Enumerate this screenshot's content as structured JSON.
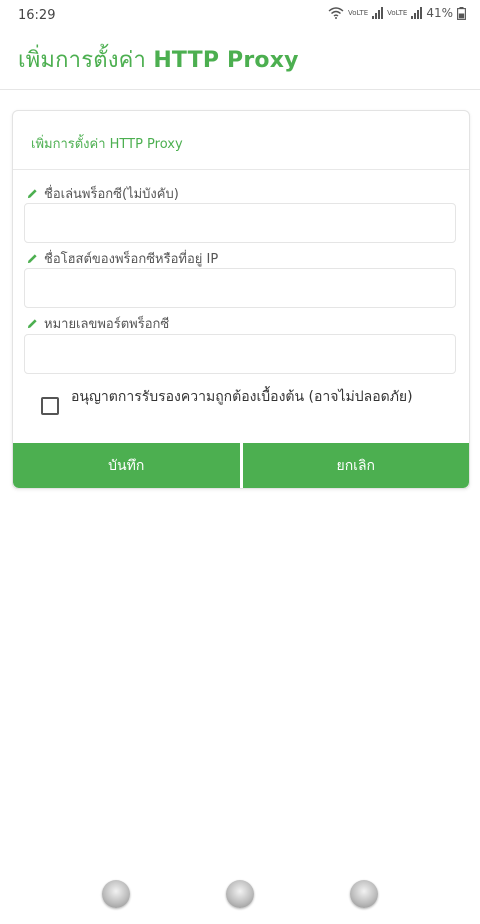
{
  "status_bar": {
    "time": "16:29",
    "network_1": "VoLTE",
    "network_2": "VoLTE",
    "battery_percent": "41%"
  },
  "app_bar": {
    "title_prefix": "เพิ่มการตั้งค่า ",
    "title_bold": "HTTP Proxy"
  },
  "card": {
    "title": "เพิ่มการตั้งค่า HTTP Proxy",
    "fields": [
      {
        "label": "ชื่อเล่นพร็อกซี(ไม่บังคับ)",
        "value": "",
        "icon": "pencil-icon"
      },
      {
        "label": "ชื่อโฮสต์ของพร็อกซีหรือที่อยู่ IP",
        "value": "",
        "icon": "pencil-icon"
      },
      {
        "label": "หมายเลขพอร์ตพร็อกซี",
        "value": "",
        "icon": "pencil-icon"
      }
    ],
    "checkbox": {
      "label": "อนุญาตการรับรองความถูกต้องเบื้องต้น (อาจไม่ปลอดภัย)",
      "checked": false
    },
    "buttons": {
      "save": "บันทึก",
      "cancel": "ยกเลิก"
    }
  },
  "colors": {
    "accent": "#4caf50",
    "button_bg": "#4caf50",
    "button_text": "#ffffff"
  },
  "nav_bar": {
    "buttons": [
      "nav-recents-icon",
      "nav-home-icon",
      "nav-back-icon"
    ]
  }
}
